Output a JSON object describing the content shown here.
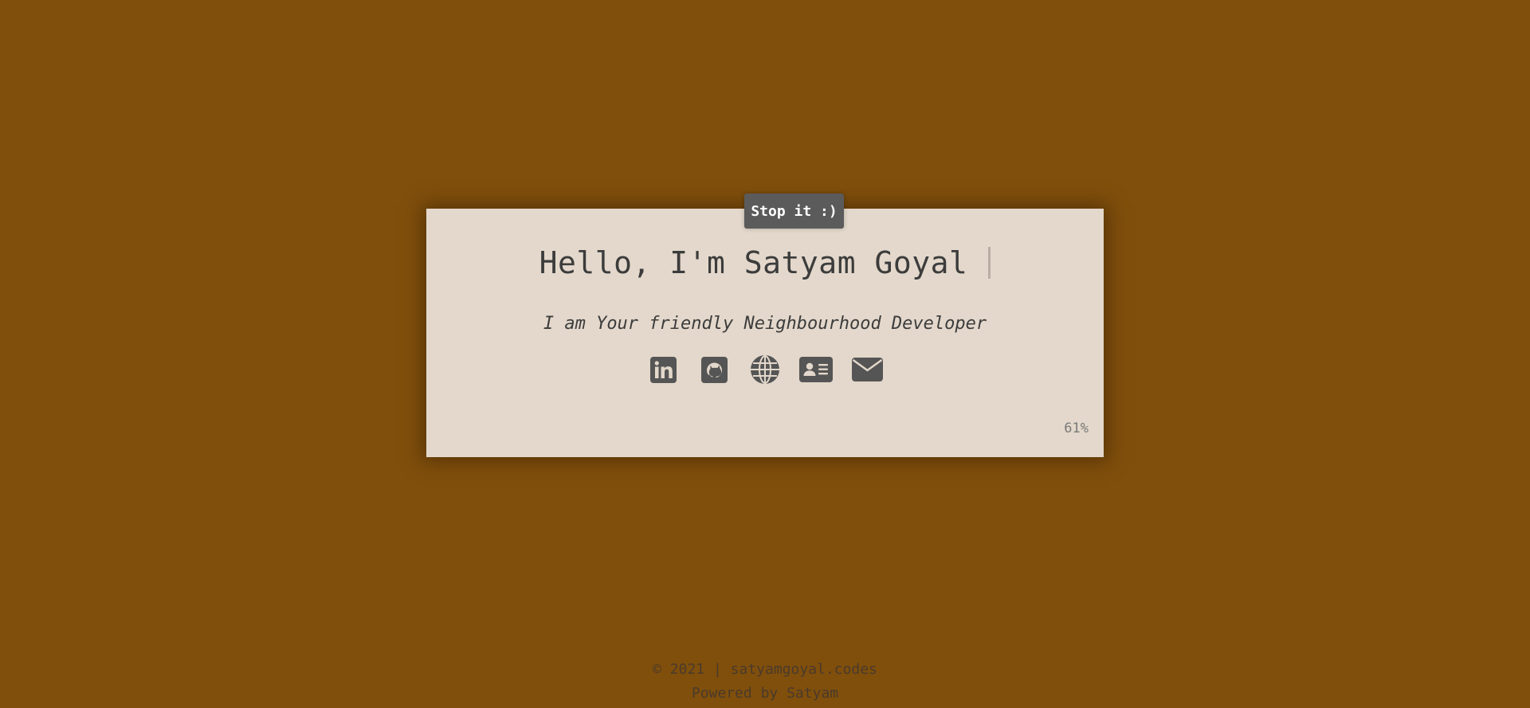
{
  "stop_button": {
    "label": "Stop it :)"
  },
  "hero": {
    "title": "Hello, I'm Satyam Goyal",
    "subtitle": "I am Your friendly Neighbourhood Developer"
  },
  "social_icons": [
    {
      "icon": "linkedin-icon"
    },
    {
      "icon": "github-icon"
    },
    {
      "icon": "globe-icon"
    },
    {
      "icon": "contact-card-icon"
    },
    {
      "icon": "envelope-icon"
    }
  ],
  "progress": {
    "text": "61%"
  },
  "footer": {
    "copyright_prefix": "© 2021 | ",
    "site_link": "satyamgoyal.codes",
    "powered_prefix": "Powered by ",
    "powered_name": "Satyam"
  },
  "colors": {
    "background": "#804f0c",
    "card": "#e3d8cb",
    "icon": "#555555",
    "button": "#5b5b5b"
  }
}
